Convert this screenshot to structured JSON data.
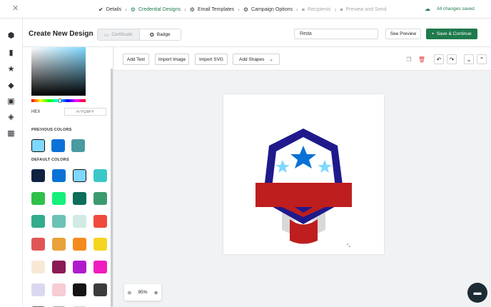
{
  "topbar": {
    "close_icon": "close-icon",
    "steps": [
      {
        "label": "Details",
        "icon": "check-icon",
        "state": "done"
      },
      {
        "label": "Credential Designs",
        "icon": "gear-icon",
        "state": "active"
      },
      {
        "label": "Email Templates",
        "icon": "gear-icon",
        "state": "todo"
      },
      {
        "label": "Campaign Options",
        "icon": "gear-icon",
        "state": "todo"
      },
      {
        "label": "Recipients",
        "icon": "lock-icon",
        "state": "locked"
      },
      {
        "label": "Preview and Send",
        "icon": "lock-icon",
        "state": "locked"
      }
    ],
    "saved_status": "All changes saved"
  },
  "rail": {
    "icons": [
      "badge-icon",
      "bookmark-icon",
      "star-icon",
      "tag-icon",
      "image-icon",
      "layers-icon",
      "qr-code-icon"
    ]
  },
  "header": {
    "title": "Create New Design",
    "toggle": {
      "certificate": "Certificate",
      "badge": "Badge",
      "selected": "Badge"
    },
    "name_value": "Reda",
    "preview_label": "See Preview",
    "save_label": "Save & Continue"
  },
  "color_panel": {
    "hex_label": "HEX",
    "hex_value": "#7FD8FF",
    "previous_label": "PREVIOUS COLORS",
    "previous_colors": [
      "#7fd8ff",
      "#0a72d6",
      "#4a9aa0"
    ],
    "default_label": "DEFAULT COLORS",
    "default_colors": [
      "#0f2240",
      "#0a72d6",
      "#7fd8ff",
      "#3cc7c7",
      "#2fc04a",
      "#16f07a",
      "#0d6e5a",
      "#3c9a70",
      "#32ad8e",
      "#6cc2b4",
      "#d0ebe4",
      "#f04a3e",
      "#e05656",
      "#e8a33a",
      "#f58a1e",
      "#f5d51e",
      "#f8e8d6",
      "#8b1b55",
      "#b01ccc",
      "#f01cbe",
      "#dad8f0",
      "#f5cdd2",
      "#141414",
      "#3c3c3c",
      "#6c6c6c",
      "#a8a8a8",
      "#d4d4d4"
    ],
    "selected_color": "#7fd8ff"
  },
  "toolbar": {
    "add_text": "Add Text",
    "import_image": "Import Image",
    "import_svg": "Import SVG",
    "add_shapes": "Add Shapes"
  },
  "zoom": {
    "level": "95%"
  },
  "badge_colors": {
    "shield": "#1f1a8c",
    "star_main": "#0a72d6",
    "star_side": "#7fd8ff",
    "ribbon": "#be1e1e",
    "accent": "#1f7a4d"
  }
}
